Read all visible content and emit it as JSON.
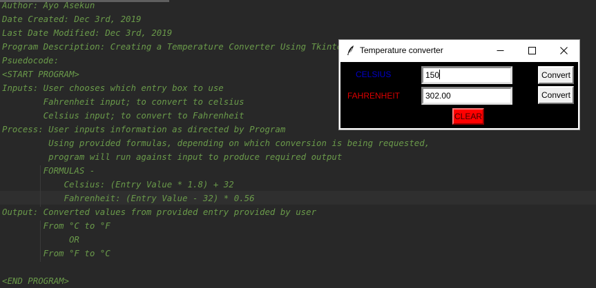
{
  "code_lines": [
    "Author: Ayo Asekun",
    "Date Created: Dec 3rd, 2019",
    "Last Date Modified: Dec 3rd, 2019",
    "Program Description: Creating a Temperature Converter Using Tkinter",
    "Psuedocode:",
    "<START PROGRAM>",
    "Inputs: User chooses which entry box to use",
    "        Fahrenheit input; to convert to celsius",
    "        Celsius input; to convert to Fahrenheit",
    "Process: User inputs information as directed by Program",
    "         Using provided formulas, depending on which conversion is being requested,",
    "         program will run against input to produce required output",
    "        FORMULAS -",
    "            Celsius: (Entry Value * 1.8) + 32",
    "            Fahrenheit: (Entry Value - 32) * 0.56",
    "Output: Converted values from provided entry provided by user",
    "        From °C to °F",
    "             OR",
    "        From °F to °C",
    "",
    "<END PROGRAM>"
  ],
  "window": {
    "title": "Temperature converter",
    "icon": "feather-icon",
    "controls": [
      "minimize-icon",
      "maximize-icon",
      "close-icon"
    ]
  },
  "converter": {
    "celsius_label": "CELSIUS",
    "fahrenheit_label": "FAHRENHEIT",
    "celsius_value": "150",
    "fahrenheit_value": "302.00",
    "convert_label_1": "Convert",
    "convert_label_2": "Convert",
    "clear_label": "CLEAR"
  },
  "colors": {
    "code_text": "#6a9a4a",
    "editor_bg": "#282828",
    "celsius_label": "#0000cc",
    "fahrenheit_label": "#dd0000",
    "clear_bg": "#ff0000"
  }
}
